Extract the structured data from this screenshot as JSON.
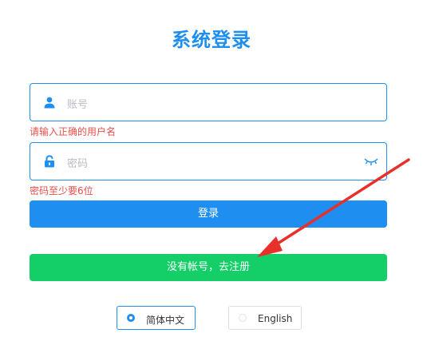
{
  "page": {
    "title": "系统登录"
  },
  "form": {
    "username": {
      "placeholder": "账号",
      "value": "",
      "error": "请输入正确的用户名"
    },
    "password": {
      "placeholder": "密码",
      "value": "",
      "error": "密码至少要6位"
    },
    "login_label": "登录",
    "register_label": "没有帐号，去注册"
  },
  "language": {
    "options": [
      "简体中文",
      "English"
    ],
    "selected": "简体中文"
  },
  "icons": {
    "username": "user-icon",
    "password": "lock-icon",
    "toggle": "eye-closed-icon",
    "annotation": "red-arrow-icon"
  },
  "colors": {
    "primary": "#1e8ff0",
    "success": "#14ce68",
    "error": "#e8504a",
    "annotation": "#e8302a"
  }
}
